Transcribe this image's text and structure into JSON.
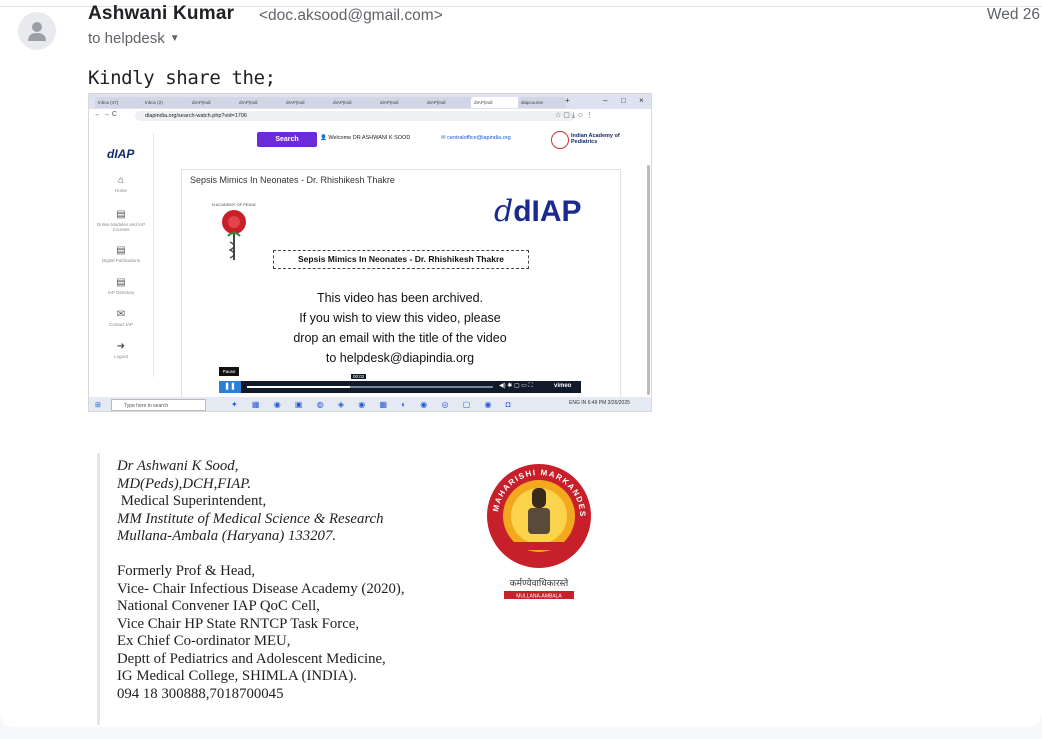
{
  "message": {
    "sender_name": "Ashwani Kumar",
    "sender_email": "<doc.aksood@gmail.com>",
    "date": "Wed 26",
    "to_label": "to helpdesk",
    "body": "Kindly share the;"
  },
  "screenshot": {
    "tabs": [
      "Inbox (47)",
      "Inbox (2)",
      "dIAP(Indi",
      "dIAP(Indi",
      "dIAP(Indi",
      "dIAP(Indi",
      "dIAP(Indi",
      "dIAP(Indi",
      "dIAP(Indi",
      "diapcourse"
    ],
    "url": "diapindia.org/search-watch.php?vid=1706",
    "search_button": "Search",
    "welcome": "Welcome DR ASHWANI K SOOD",
    "central_email": "centraloffice@iapindia.org",
    "iap_name_line1": "Indian Academy of",
    "iap_name_line2": "Pediatrics",
    "site_logo": "dIAP",
    "sidebar": [
      "Home",
      "Online Modules and IAP Courses",
      "Digital Publications",
      "IAP Directory",
      "Contact IAP",
      "Logout"
    ],
    "video_title": "Sepsis Mimics In Neonates - Dr. Rhishikesh Thakre",
    "seal_text": "INDIAN ACADEMY OF PEDIATRICS",
    "video_logo": "dIAP",
    "video_caption": "Sepsis Mimics In Neonates - Dr. Rhishikesh Thakre",
    "archived_1": "This video has been archived.",
    "archived_2": "If you wish to view this video, please",
    "archived_3": "drop an email with the title of the video",
    "archived_4": "to helpdesk@diapindia.org",
    "pause_tip": "Pause",
    "time": "00:02",
    "progress": 0.42,
    "vimeo": "vimeo",
    "taskbar_search": "Type here to search",
    "tray_lang": "ENG IN",
    "tray_time": "6:49 PM",
    "tray_date": "3/26/2025"
  },
  "signature": {
    "line1": "Dr Ashwani K Sood,",
    "line2": "MD(Peds),DCH,FIAP.",
    "line3": " Medical Superintendent,",
    "line4": "MM Institute of Medical Science & Research",
    "line5": "Mullana-Ambala (Haryana) 133207.",
    "line6": "Formerly Prof & Head,",
    "line7": "Vice- Chair Infectious Disease Academy (2020),",
    "line8": "National Convener IAP QoC Cell,",
    "line9": "Vice Chair HP State RNTCP Task Force,",
    "line10": "Ex Chief Co-ordinator MEU,",
    "line11": "Deptt of Pediatrics and Adolescent Medicine,",
    "line12": "IG Medical College, SHIMLA (INDIA).",
    "line13": "094 18 300888,7018700045",
    "logo_text": "MAHARISHI MARKANDESHWAR",
    "logo_bottom": "MULLANA-AMBALA"
  },
  "colors": {
    "accent": "#6c2bd9",
    "logo_red": "#c8202a",
    "navy": "#1b2a8f"
  }
}
